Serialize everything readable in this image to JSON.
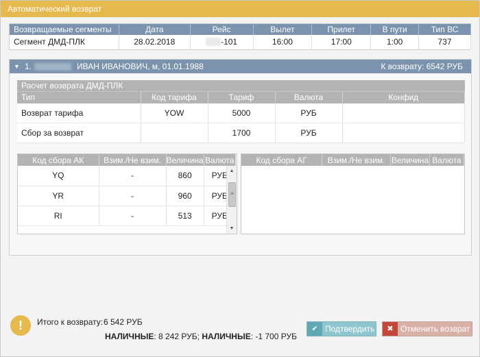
{
  "window": {
    "title": "Автоматический возврат"
  },
  "segments": {
    "headers": [
      "Возвращаемые сегменты",
      "Дата",
      "Рейс",
      "Вылет",
      "Прилет",
      "В пути",
      "Тип ВС"
    ],
    "row": {
      "segment": "Сегмент ДМД-ПЛК",
      "date": "28.02.2018",
      "flight": "-101",
      "departure": "16:00",
      "arrival": "17:00",
      "duration": "1:00",
      "aircraft": "737"
    }
  },
  "passenger": {
    "number": "1.",
    "name": "ИВАН ИВАНОВИЧ, м, 01.01.1988",
    "refund": "К возврату: 6542 РУБ",
    "calc": {
      "title": "Расчет возврата ДМД-ПЛК",
      "headers": [
        "Тип",
        "Код тарифа",
        "Тариф",
        "Валюта",
        "Конфид"
      ],
      "rows": [
        {
          "type": "Возврат тарифа",
          "code": "YOW",
          "tariff": "5000",
          "currency": "РУБ",
          "conf": ""
        },
        {
          "type": "Сбор за возврат",
          "code": "",
          "tariff": "1700",
          "currency": "РУБ",
          "conf": ""
        }
      ]
    },
    "fees_ak": {
      "headers": [
        "Код сбора АК",
        "Взим./Не взим.",
        "Величина",
        "Валюта"
      ],
      "rows": [
        {
          "code": "YQ",
          "charged": "-",
          "amount": "860",
          "currency": "РУБ"
        },
        {
          "code": "YR",
          "charged": "-",
          "amount": "960",
          "currency": "РУБ"
        },
        {
          "code": "RI",
          "charged": "-",
          "amount": "513",
          "currency": "РУБ"
        }
      ]
    },
    "fees_ag": {
      "headers": [
        "Код сбора АГ",
        "Взим./Не взим.",
        "Величина",
        "Валюта"
      ]
    }
  },
  "footer": {
    "total_label": "Итого к возврату:",
    "total_value": "6 542 РУБ",
    "pay1_label": "НАЛИЧНЫЕ",
    "pay1_value": ": 8 242 РУБ;",
    "pay2_label": "НАЛИЧНЫЕ",
    "pay2_value": ": -1 700 РУБ",
    "confirm_label": "Подтвердить",
    "cancel_label": "Отменить возврат"
  }
}
